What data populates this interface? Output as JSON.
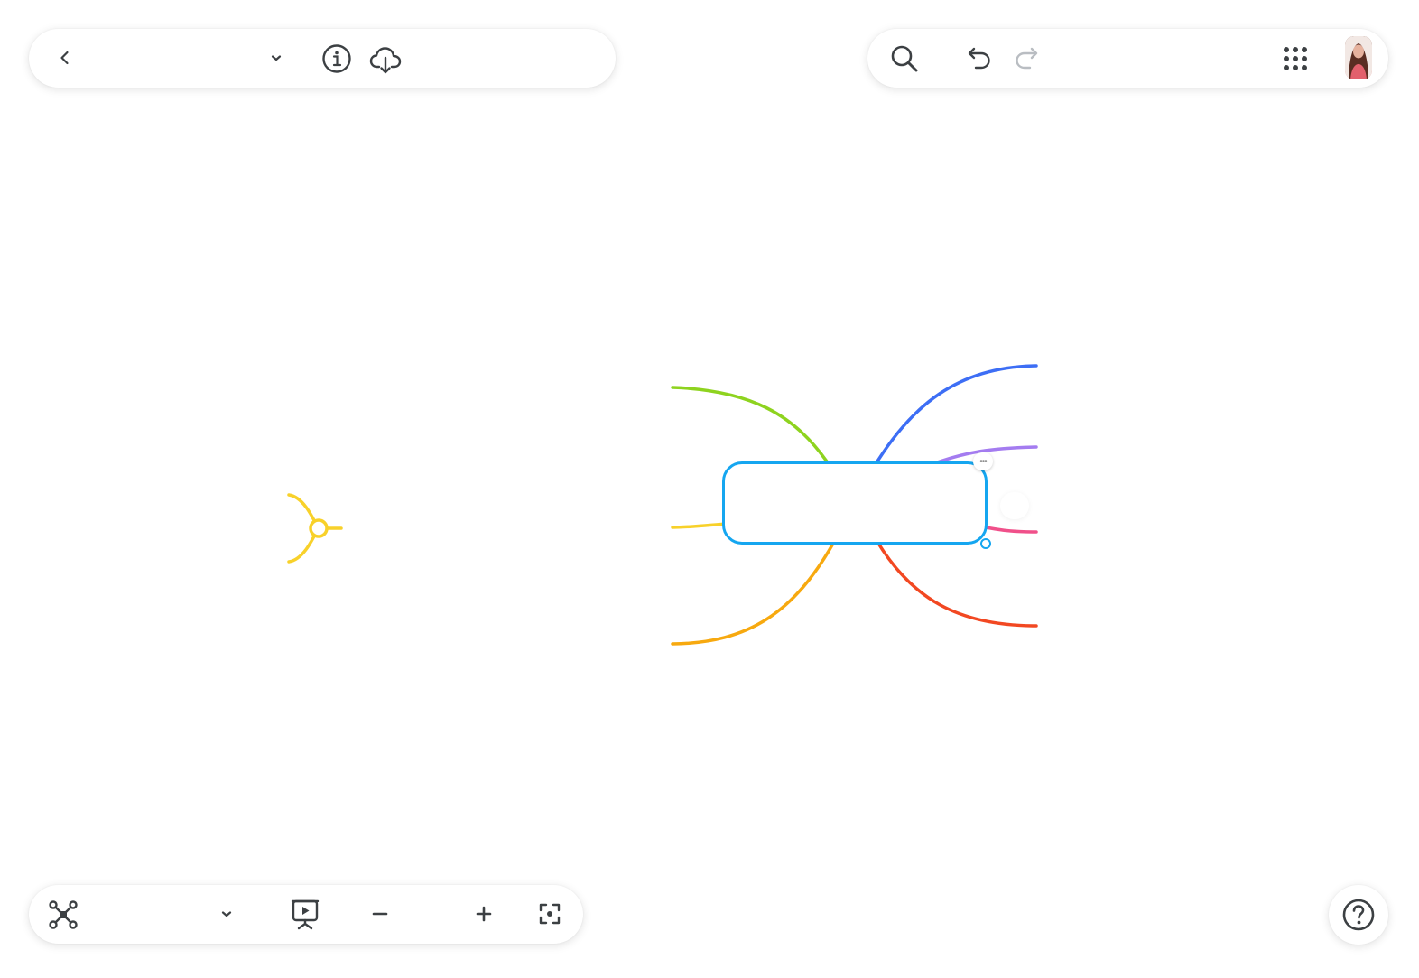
{
  "top_left_bar": {
    "back_icon": "chevron-left-icon",
    "document_title": "",
    "title_dropdown_icon": "chevron-down-icon",
    "info_icon": "info-icon",
    "cloud_download_icon": "cloud-download-icon"
  },
  "top_right_bar": {
    "search_icon": "search-icon",
    "undo_icon": "undo-icon",
    "redo_icon": "redo-icon",
    "apps_icon": "grid-dots-icon",
    "avatar": "user-avatar"
  },
  "bottom_left_bar": {
    "layout_icon": "mindmap-layout-icon",
    "layout_label": "",
    "layout_dropdown_icon": "chevron-down-icon",
    "presentation_icon": "presentation-play-icon",
    "zoom_out_icon": "minus-icon",
    "zoom_level": "",
    "zoom_in_icon": "plus-icon",
    "fit_icon": "fit-to-screen-icon"
  },
  "help": {
    "icon": "help-circle-icon"
  },
  "mindmap": {
    "central_topic": "",
    "branch_colors": {
      "green": "#8ed31f",
      "blue": "#3d6ef5",
      "purple": "#a47cf0",
      "yellow": "#f8d12a",
      "pink": "#f0508a",
      "orange": "#f7a90f",
      "red": "#f24822"
    },
    "selection_color": "#15a6f0",
    "floating_node_color": "#f8d12a"
  },
  "colors": {
    "icon": "#3c4043",
    "icon_disabled": "#b9bdc2",
    "toolbar_bg": "#ffffff"
  }
}
